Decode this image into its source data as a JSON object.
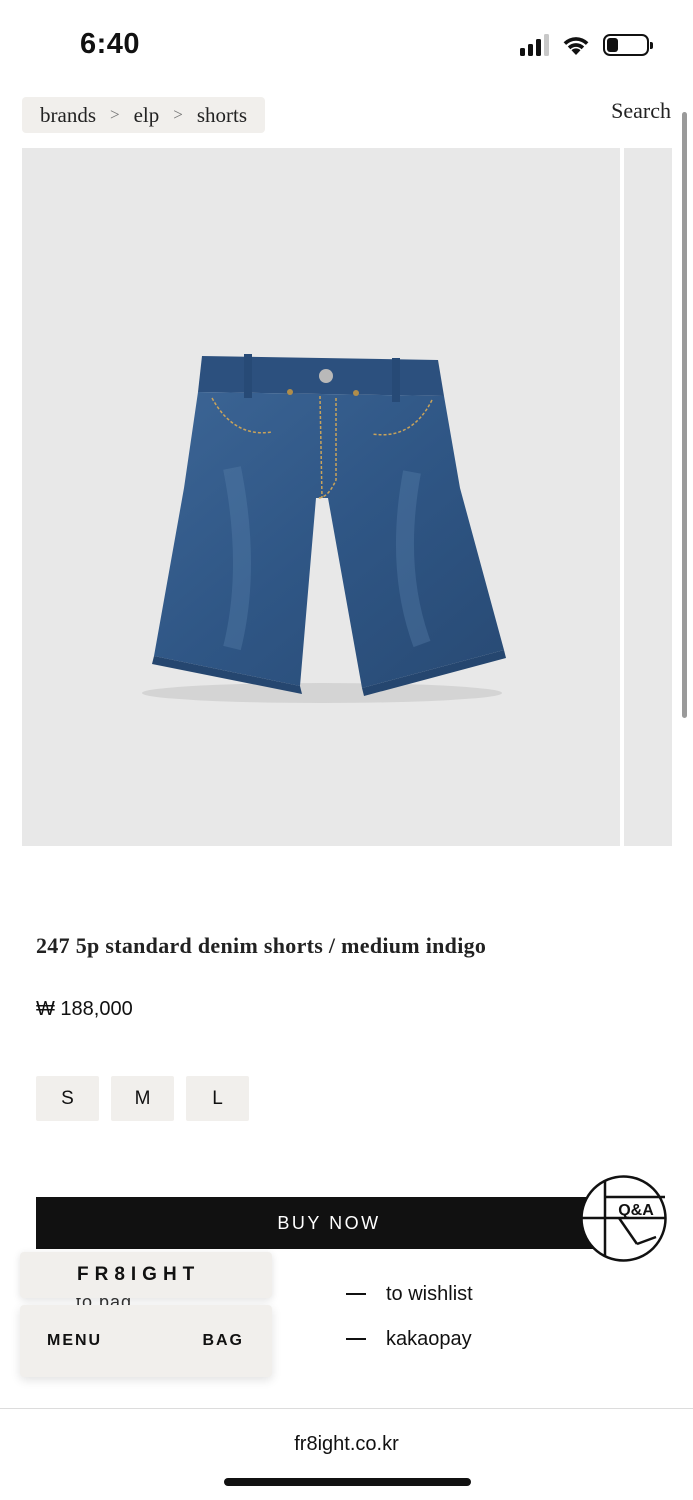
{
  "status_bar": {
    "time": "6:40",
    "icons": [
      "cellular-signal-icon",
      "wifi-icon",
      "battery-icon"
    ]
  },
  "breadcrumb": {
    "items": [
      "brands",
      "elp",
      "shorts"
    ],
    "separator": ">"
  },
  "header": {
    "search_label": "Search"
  },
  "product": {
    "title": "247 5p standard denim shorts / medium indigo",
    "price": "₩ 188,000",
    "sizes": [
      "S",
      "M",
      "L"
    ]
  },
  "buy_now_label": "BUY NOW",
  "qa_badge_label": "Q&A",
  "actions": [
    {
      "label": "to wishlist"
    },
    {
      "label": "kakaopay"
    }
  ],
  "hidden_action_label": "to bag",
  "brand": {
    "name": "FR8IGHT"
  },
  "nav": {
    "menu_label": "MENU",
    "bag_label": "BAG"
  },
  "url_bar": {
    "domain": "fr8ight.co.kr"
  },
  "colors": {
    "accent": "#111111",
    "panel_bg": "#f1efec",
    "image_bg": "#e8e8e8",
    "denim": "#2f5685"
  }
}
